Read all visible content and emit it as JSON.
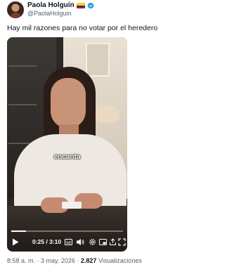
{
  "author": {
    "name": "Paola Holguín",
    "handle": "@PaolaHolguin",
    "flag_icon": "colombia-flag-icon",
    "verified_icon": "verified-badge-icon",
    "verified_color": "#1d9bf0"
  },
  "tweet": {
    "text": "Hay mil razones para no votar por el heredero"
  },
  "video": {
    "caption": "encanta",
    "current_time": "0:25",
    "separator": " / ",
    "duration": "3:10",
    "progress_fraction": 0.13,
    "controls": [
      "play-icon",
      "captions-icon",
      "volume-icon",
      "settings-icon",
      "picture-in-picture-icon",
      "share-icon",
      "fullscreen-icon"
    ]
  },
  "meta": {
    "time": "8:58 a. m.",
    "dot": " · ",
    "date": "3 may. 2026",
    "views_count": "2.827",
    "views_label": "Visualizaciones"
  }
}
